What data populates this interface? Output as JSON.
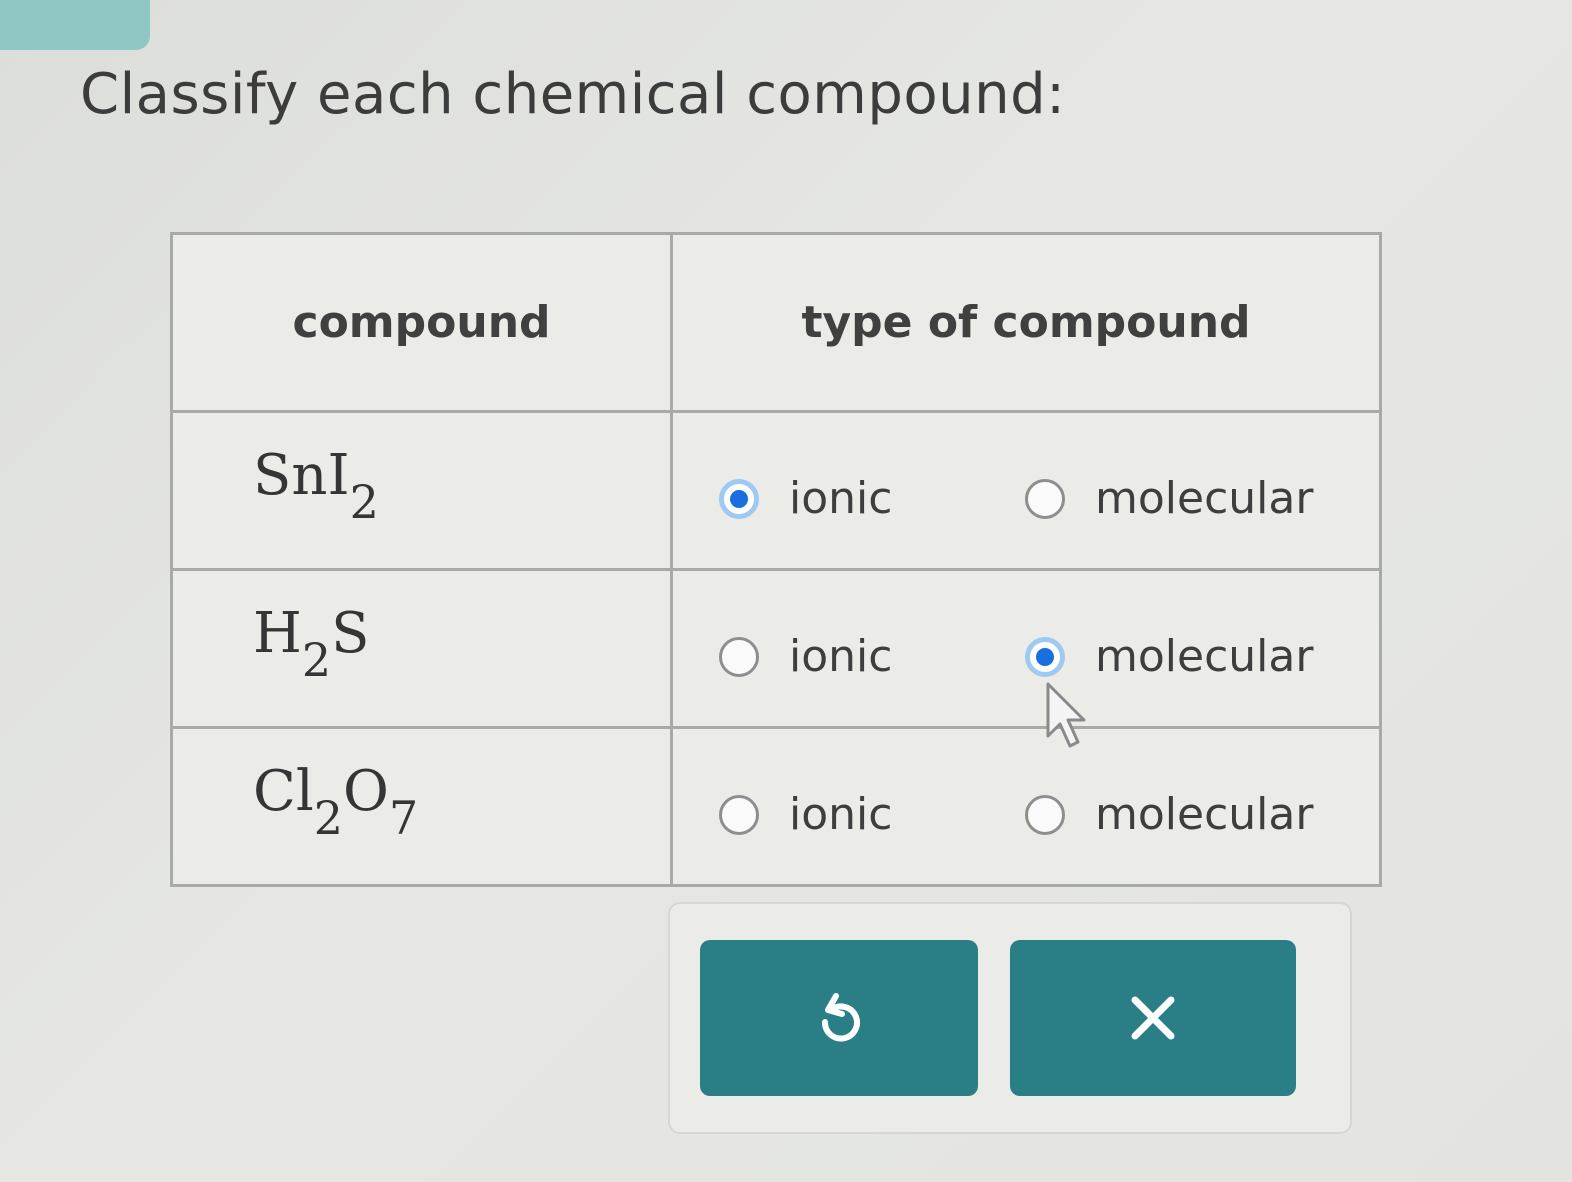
{
  "prompt": "Classify each chemical compound:",
  "table": {
    "headers": [
      "compound",
      "type of compound"
    ],
    "rows": [
      {
        "base": [
          "Sn",
          "I"
        ],
        "subs": [
          "",
          "2"
        ],
        "options": [
          "ionic",
          "molecular"
        ],
        "selected": "ionic"
      },
      {
        "base": [
          "H",
          "S"
        ],
        "subs": [
          "2",
          ""
        ],
        "options": [
          "ionic",
          "molecular"
        ],
        "selected": "molecular"
      },
      {
        "base": [
          "Cl",
          "O"
        ],
        "subs": [
          "2",
          "7"
        ],
        "options": [
          "ionic",
          "molecular"
        ],
        "selected": null
      }
    ]
  },
  "actions": {
    "reset_icon": "undo-icon",
    "clear_icon": "close-icon"
  },
  "colors": {
    "accent_button": "#2a7f87",
    "radio_selected": "#1a6fe0",
    "tab": "#8fc7c4"
  }
}
